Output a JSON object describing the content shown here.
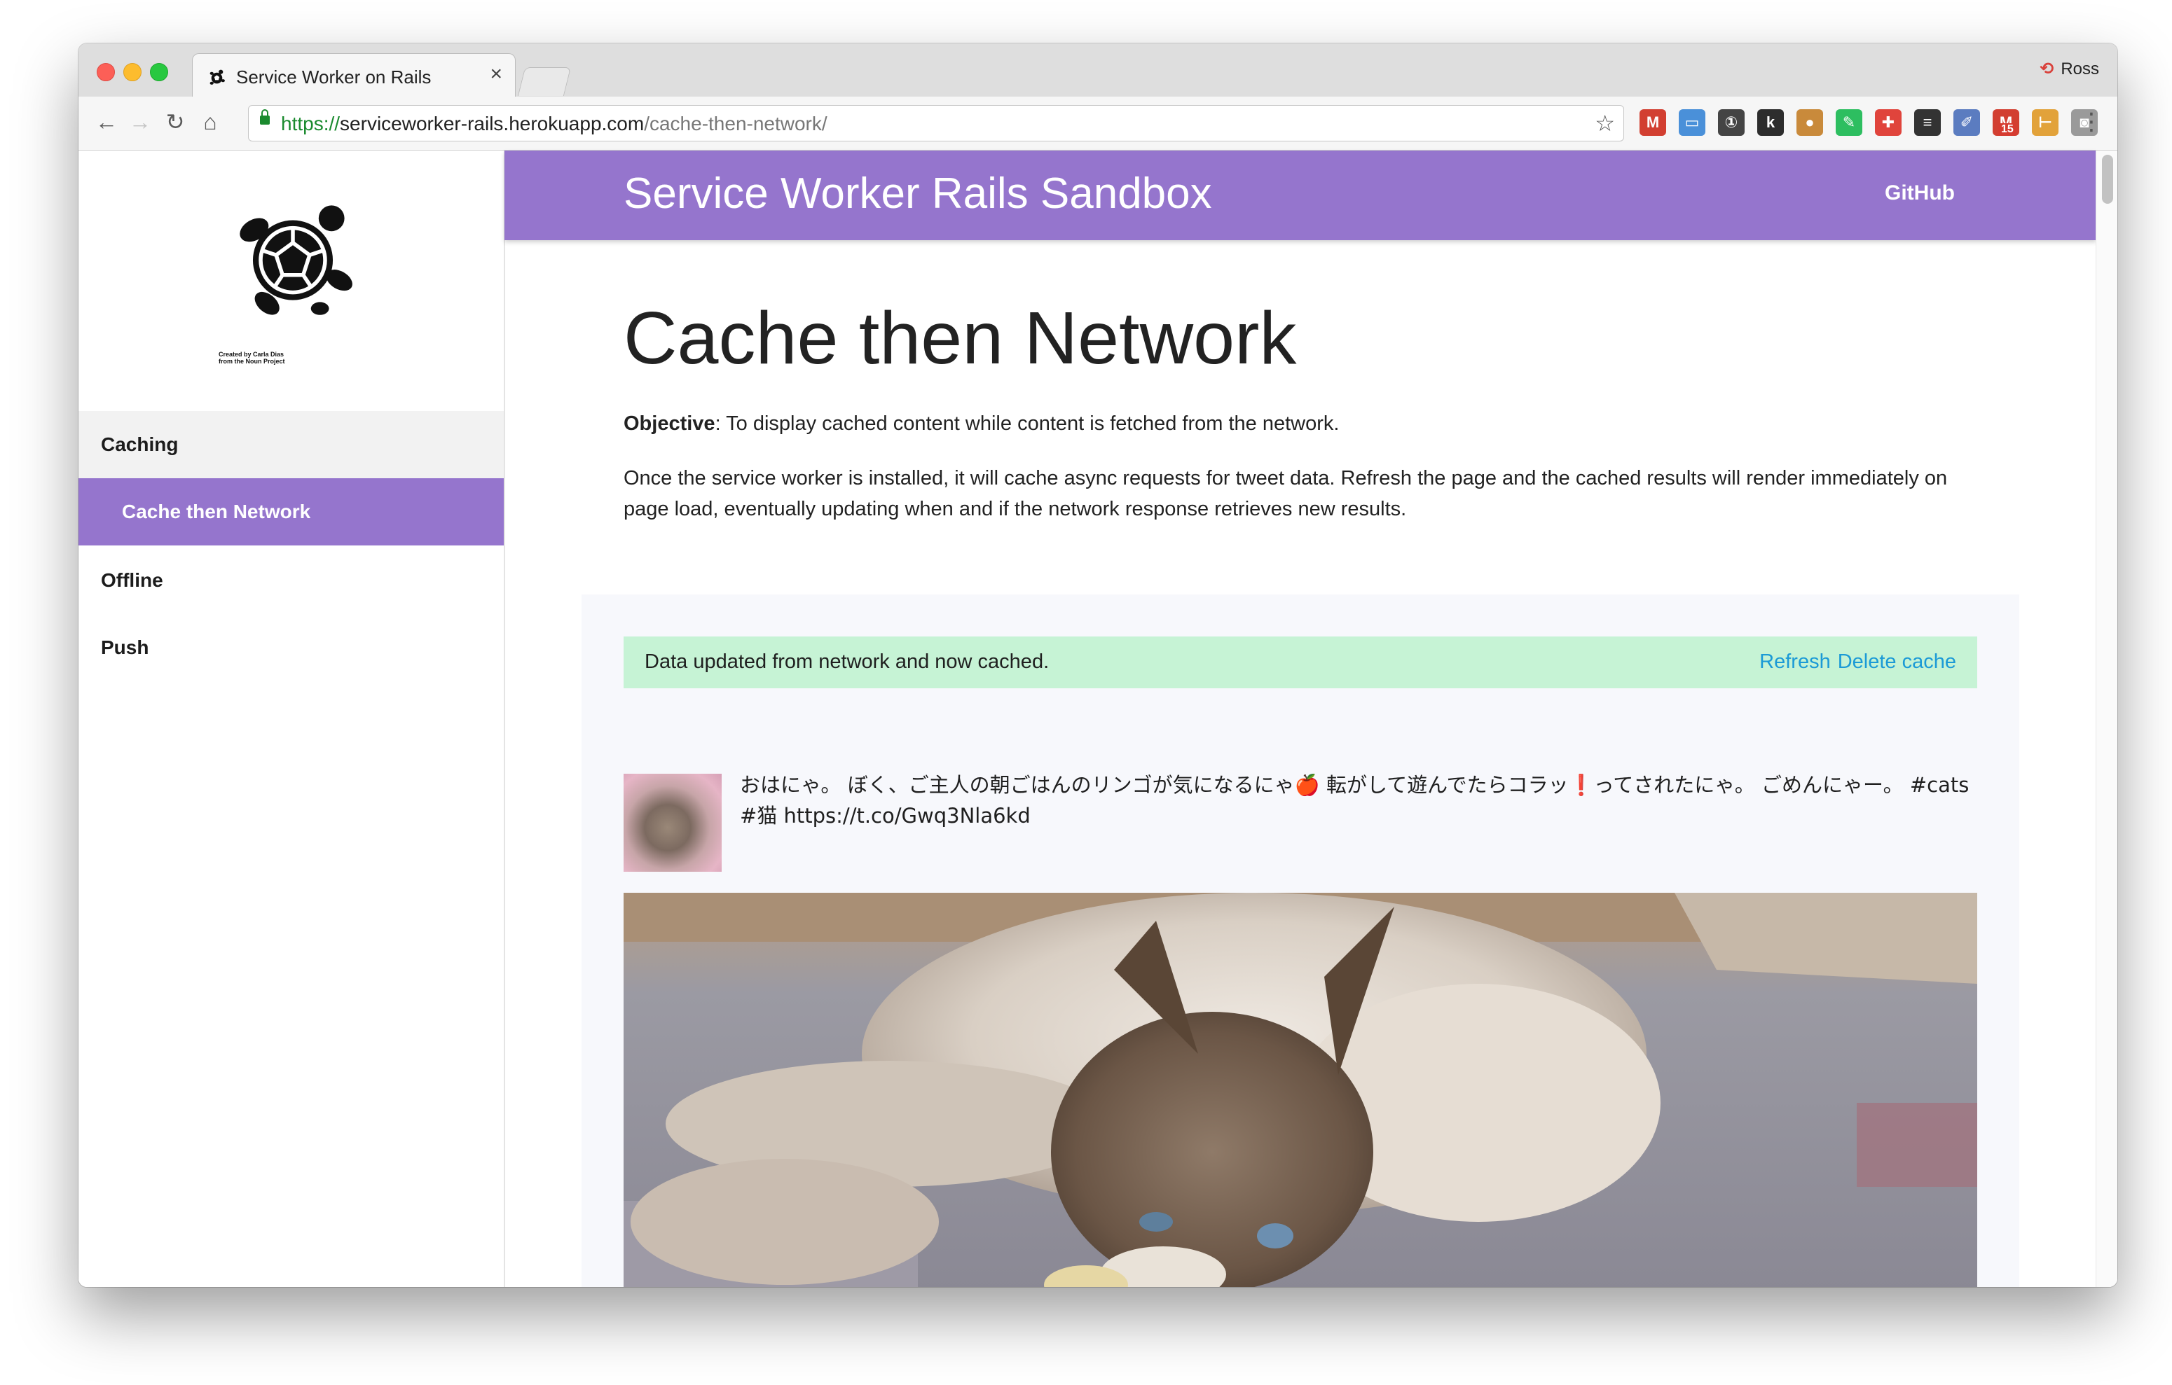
{
  "browser": {
    "tab_title": "Service Worker on Rails",
    "tab_close": "×",
    "profile_name": "Ross",
    "url_scheme": "https://",
    "url_host": "serviceworker-rails.herokuapp.com",
    "url_path": "/cache-then-network/",
    "nav": {
      "back": "←",
      "forward": "→",
      "reload": "↻",
      "home": "⌂"
    },
    "star": "☆",
    "menu": "⋮",
    "extensions": [
      {
        "name": "gmail-icon",
        "label": "M",
        "color": "#d23f31"
      },
      {
        "name": "folder-icon",
        "label": "▭",
        "color": "#4a90d9"
      },
      {
        "name": "onepassword-icon",
        "label": "①",
        "color": "#444444"
      },
      {
        "name": "k-extension-icon",
        "label": "k",
        "color": "#2d2d2d"
      },
      {
        "name": "cookie-icon",
        "label": "●",
        "color": "#c98a3b"
      },
      {
        "name": "evernote-icon",
        "label": "✎",
        "color": "#2dbe60"
      },
      {
        "name": "medical-cross-icon",
        "label": "✚",
        "color": "#e0443c"
      },
      {
        "name": "buffer-icon",
        "label": "≡",
        "color": "#333333"
      },
      {
        "name": "eyedropper-icon",
        "label": "✐",
        "color": "#5b7cc0"
      },
      {
        "name": "gmail-notifier-icon",
        "label": "M",
        "color": "#d23f31",
        "badge": "15"
      },
      {
        "name": "ruler-icon",
        "label": "⊢",
        "color": "#e2a23a"
      },
      {
        "name": "camera-icon",
        "label": "◙",
        "color": "#9a9a9a"
      }
    ]
  },
  "sidebar": {
    "logo_credit_line1": "Created by Carla Dias",
    "logo_credit_line2": "from the Noun Project",
    "section_label": "Caching",
    "active_label": "Cache then Network",
    "items": [
      {
        "label": "Offline"
      },
      {
        "label": "Push"
      }
    ]
  },
  "header": {
    "title": "Service Worker Rails Sandbox",
    "link": "GitHub"
  },
  "main": {
    "title": "Cache then Network",
    "objective_label": "Objective",
    "objective_text": ": To display cached content while content is fetched from the network.",
    "description": "Once the service worker is installed, it will cache async requests for tweet data. Refresh the page and the cached results will render immediately on page load, eventually updating when and if the network response retrieves new results.",
    "status_message": "Data updated from network and now cached.",
    "refresh_label": "Refresh",
    "delete_cache_label": "Delete cache",
    "tweet_text": "おはにゃ。 ぼく、ご主人の朝ごはんのリンゴが気になるにゃ🍎 転がして遊んでたらコラッ❗ってされたにゃ。 ごめんにゃー。 #cats #猫 https://t.co/Gwq3Nla6kd"
  },
  "colors": {
    "accent": "#9575cd",
    "alert_bg": "#c6f3d5",
    "link": "#1b9ad6"
  }
}
